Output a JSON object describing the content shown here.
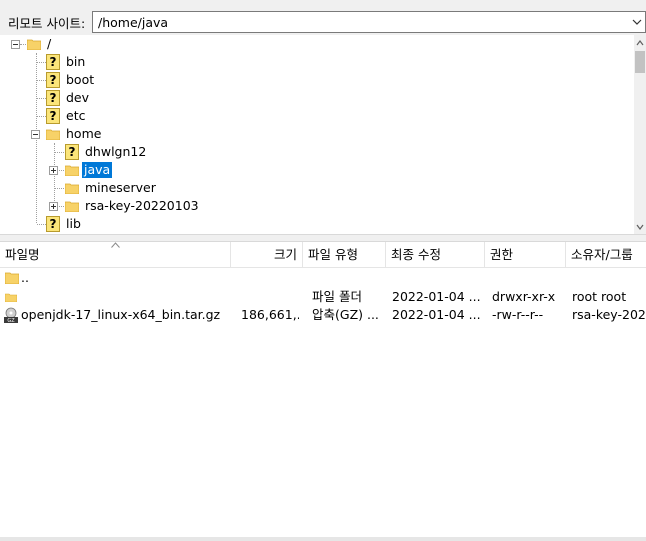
{
  "site_bar": {
    "label": "리모트 사이트:",
    "path_value": "/home/java"
  },
  "tree": {
    "nodes": [
      {
        "label": "/",
        "icon": "folder-icon",
        "expander": "minus"
      },
      {
        "label": "bin",
        "icon": "unknown-folder-icon"
      },
      {
        "label": "boot",
        "icon": "unknown-folder-icon"
      },
      {
        "label": "dev",
        "icon": "unknown-folder-icon"
      },
      {
        "label": "etc",
        "icon": "unknown-folder-icon"
      },
      {
        "label": "home",
        "icon": "folder-icon",
        "expander": "minus"
      },
      {
        "label": "dhwlgn12",
        "icon": "unknown-folder-icon"
      },
      {
        "label": "java",
        "icon": "folder-icon",
        "expander": "plus",
        "selected": true
      },
      {
        "label": "mineserver",
        "icon": "folder-icon"
      },
      {
        "label": "rsa-key-20220103",
        "icon": "folder-icon",
        "expander": "plus"
      },
      {
        "label": "lib",
        "icon": "unknown-folder-icon"
      }
    ]
  },
  "columns": {
    "name": "파일명",
    "size": "크기",
    "type": "파일 유형",
    "modified": "최종 수정",
    "perms": "권한",
    "owner": "소유자/그룹"
  },
  "files": [
    {
      "name": "..",
      "size": "",
      "type": "",
      "modified": "",
      "perms": "",
      "owner": "",
      "icon": "parent-folder-icon"
    },
    {
      "name": "",
      "size": "",
      "type": "파일 폴더",
      "modified": "2022-01-04 ...",
      "perms": "drwxr-xr-x",
      "owner": "root root",
      "icon": "folder-icon"
    },
    {
      "name": "openjdk-17_linux-x64_bin.tar.gz",
      "size": "186,661,...",
      "type": "압축(GZ) ...",
      "modified": "2022-01-04 ...",
      "perms": "-rw-r--r--",
      "owner": "rsa-key-202...",
      "icon": "gz-archive-icon"
    }
  ],
  "colors": {
    "folder": "#f7d268",
    "selection": "#0078d7"
  }
}
